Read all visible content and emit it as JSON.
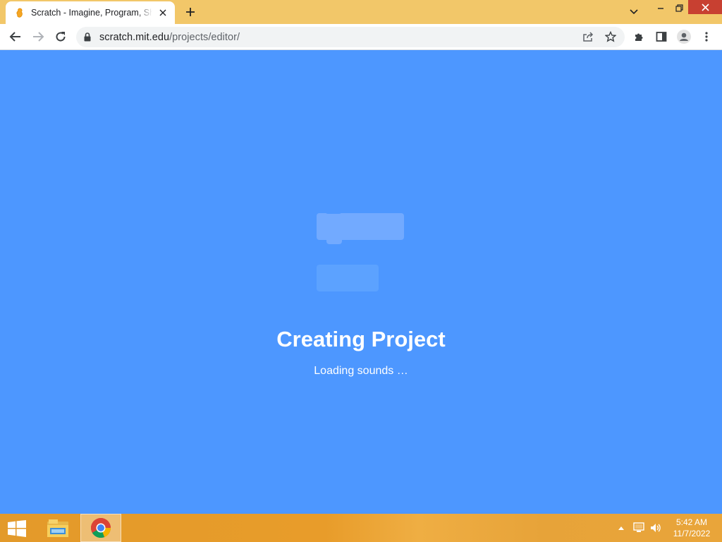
{
  "browser": {
    "tab": {
      "title": "Scratch - Imagine, Program, Share",
      "favicon": "scratch-cat-icon"
    },
    "url": {
      "host": "scratch.mit.edu",
      "path": "/projects/editor/"
    },
    "icons": [
      "back-icon",
      "forward-icon",
      "reload-icon",
      "lock-icon",
      "share-icon",
      "star-icon",
      "extensions-icon",
      "side-panel-icon",
      "profile-icon",
      "menu-icon"
    ]
  },
  "page": {
    "title": "Creating Project",
    "status": "Loading sounds …",
    "background": "#4d97ff"
  },
  "taskbar": {
    "clock": {
      "time": "5:42 AM",
      "date": "11/7/2022"
    },
    "apps": [
      "file-explorer-icon",
      "chrome-icon"
    ]
  }
}
